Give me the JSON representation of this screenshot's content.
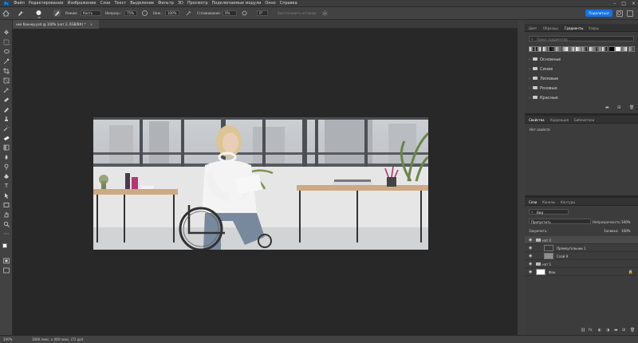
{
  "app": {
    "logo": "Ps"
  },
  "menu": [
    "Файл",
    "Редактирование",
    "Изображение",
    "Слои",
    "Текст",
    "Выделение",
    "Фильтр",
    "3D",
    "Просмотр",
    "Подключаемые модули",
    "Окно",
    "Справка"
  ],
  "options": {
    "brush_size": "30",
    "mode_label": "Режим:",
    "mode_value": "Кисть",
    "opacity_label": "Непрозр.:",
    "opacity_value": "75%",
    "flow_label": "Наж.:",
    "flow_value": "100%",
    "smoothing_label": "Сглаживание:",
    "smoothing_value": "0%",
    "angle_value": "0°",
    "restore_history": "Восстановить историю",
    "share_label": "Поделиться"
  },
  "document": {
    "tab_title": "нке баннер.psd @ 100% (нат 2, RGB/8#) *",
    "close": "×"
  },
  "status": {
    "zoom": "100%",
    "doc_info": "1000 пикс. x 400 пикс. (72 ppi)"
  },
  "panels": {
    "top_tabs": [
      "Цвет",
      "Образцы",
      "Градиенты",
      "Узоры"
    ],
    "top_active": 2,
    "gradient_search_placeholder": "Поиск градиентов",
    "gradient_folders": [
      "Основные",
      "Синие",
      "Лиловые",
      "Розовые",
      "Красные"
    ],
    "props_tabs": [
      "Свойства",
      "Коррекция",
      "Библиотеки"
    ],
    "props_active": 0,
    "props_text": "Нет свойств",
    "layers_tabs": [
      "Слои",
      "Каналы",
      "Контуры"
    ],
    "layers_active": 0,
    "layers_filter": "Вид",
    "blend_mode": "Пропустить",
    "opacity_label": "Непрозрачность:",
    "opacity_value": "100%",
    "lock_label": "Закрепить:",
    "fill_label": "Заливка:",
    "fill_value": "100%",
    "layers": [
      {
        "name": "нат 2",
        "type": "group"
      },
      {
        "name": "Прямоугольник 1",
        "type": "shape"
      },
      {
        "name": "Слой 9",
        "type": "image"
      },
      {
        "name": "нат 1",
        "type": "group"
      },
      {
        "name": "Фон",
        "type": "background"
      }
    ]
  },
  "colors": {
    "accent": "#1473e6",
    "canvas_bg": "#282828",
    "panel_bg": "#3c3c3c"
  },
  "icons": [
    "brush-icon",
    "move-icon",
    "eye-icon",
    "folder-icon",
    "search-icon",
    "home-icon"
  ]
}
